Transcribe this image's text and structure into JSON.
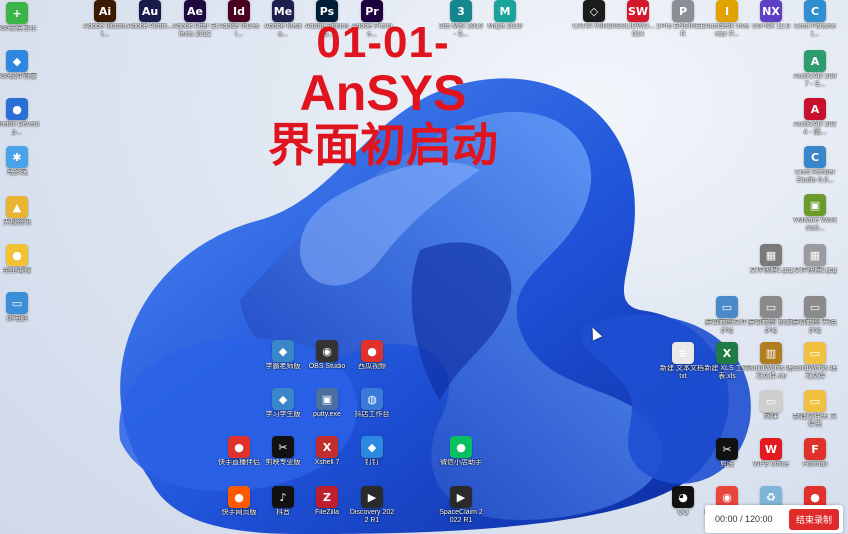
{
  "overlay": {
    "line1": "01-01-",
    "line2": "AnSYS",
    "line3": "界面初启动"
  },
  "recorder": {
    "time": "00:00 / 120:00",
    "stop_label": "结束录制"
  },
  "icons": [
    {
      "name": "icon-360-safeguard",
      "label": "360安全卫士",
      "glyph": "+",
      "color": "#3bb54a"
    },
    {
      "name": "icon-360-software",
      "label": "360软件管家",
      "glyph": "◆",
      "color": "#2f86e0"
    },
    {
      "name": "icon-firefox",
      "label": "Firefox Develop...",
      "glyph": "●",
      "color": "#2b6fd6"
    },
    {
      "name": "icon-app-4",
      "label": "马多玩",
      "glyph": "✱",
      "color": "#4aa3e8"
    },
    {
      "name": "icon-app-5",
      "label": "天极资讯",
      "glyph": "▲",
      "color": "#e8b431"
    },
    {
      "name": "icon-app-6",
      "label": "金山毒霸",
      "glyph": "●",
      "color": "#f1c232"
    },
    {
      "name": "icon-this-pc",
      "label": "此电脑",
      "glyph": "▭",
      "color": "#3a8fd8"
    },
    {
      "name": "icon-illustrator",
      "label": "Adobe Illustrat...",
      "glyph": "Ai",
      "color": "#3a1a00"
    },
    {
      "name": "icon-audition",
      "label": "Adobe Auditi...",
      "glyph": "Au",
      "color": "#1a1a4a"
    },
    {
      "name": "icon-after-effects",
      "label": "Adobe After Effects 2022",
      "glyph": "Ae",
      "color": "#1f0a3f"
    },
    {
      "name": "icon-indesign",
      "label": "Adobe InDesi...",
      "glyph": "Id",
      "color": "#49021f"
    },
    {
      "name": "icon-media-encoder",
      "label": "Adobe Media...",
      "glyph": "Me",
      "color": "#1f1f4f"
    },
    {
      "name": "icon-photoshop",
      "label": "Adobe Photosho...",
      "glyph": "Ps",
      "color": "#001e36"
    },
    {
      "name": "icon-premiere",
      "label": "Adobe Premie...",
      "glyph": "Pr",
      "color": "#1f003f"
    },
    {
      "name": "icon-3dsmax",
      "label": "3ds Max 2019 - S...",
      "glyph": "3",
      "color": "#14878e"
    },
    {
      "name": "icon-maya",
      "label": "Maya 2019",
      "glyph": "M",
      "color": "#1aa39b"
    },
    {
      "name": "icon-catia",
      "label": "CATIA V5R20",
      "glyph": "◇",
      "color": "#1c1c1c"
    },
    {
      "name": "icon-solidworks-2024",
      "label": "SOLIDWO... 2024",
      "glyph": "SW",
      "color": "#d5172b"
    },
    {
      "name": "icon-pro-engineer",
      "label": "Pro ENGINEER",
      "glyph": "P",
      "color": "#8a8f96"
    },
    {
      "name": "icon-autodesk-inventor",
      "label": "Autodesk Inventor P...",
      "glyph": "I",
      "color": "#e0a200"
    },
    {
      "name": "icon-ug-nx",
      "label": "UG-NX 12.0",
      "glyph": "NX",
      "color": "#5f3fc4"
    },
    {
      "name": "icon-creo-parametric",
      "label": "Creo Paramet...",
      "glyph": "C",
      "color": "#2f8fd0"
    },
    {
      "name": "icon-autocad-2007",
      "label": "AutoCAD 2007 - S...",
      "glyph": "A",
      "color": "#2e9c6f"
    },
    {
      "name": "icon-autocad-2024",
      "label": "AutoCAD 2024 - 简...",
      "glyph": "A",
      "color": "#c8102e"
    },
    {
      "name": "icon-creo-render",
      "label": "Creo Render Studio 6.0...",
      "glyph": "C",
      "color": "#3a86c8"
    },
    {
      "name": "icon-vmware",
      "label": "VMware Workstati...",
      "glyph": "▣",
      "color": "#6a9a2a"
    },
    {
      "name": "icon-file-jpg-1",
      "label": "文件快照1.jpg",
      "glyph": "▦",
      "color": "#7a7a7a"
    },
    {
      "name": "icon-file-jpg-2",
      "label": "文件快照2.jpg",
      "glyph": "▦",
      "color": "#9a9aa0"
    },
    {
      "name": "icon-file-png-1",
      "label": "屏幕截图文件.png",
      "glyph": "▭",
      "color": "#4a8ac8"
    },
    {
      "name": "icon-file-png-2",
      "label": "屏幕截图 资源.png",
      "glyph": "▭",
      "color": "#8a8a8a"
    },
    {
      "name": "icon-file-png-3",
      "label": "屏幕截图 开始.png",
      "glyph": "▭",
      "color": "#8a8a8a"
    },
    {
      "name": "icon-new-txt",
      "label": "新建 文本文档.txt",
      "glyph": "≡",
      "color": "#e8e8e8"
    },
    {
      "name": "icon-new-xls",
      "label": "新建 XLS 工作表.xls",
      "glyph": "X",
      "color": "#1f7a45"
    },
    {
      "name": "icon-solidworks-rar",
      "label": "SolidWorks 练习文件.rar",
      "glyph": "▥",
      "color": "#b07d1f"
    },
    {
      "name": "icon-solidworks-folder",
      "label": "SolidWorks 练习文件",
      "glyph": "▭",
      "color": "#f0c040"
    },
    {
      "name": "icon-file-misc",
      "label": "网课",
      "glyph": "▭",
      "color": "#cfcfcf"
    },
    {
      "name": "icon-folder-new",
      "label": "新建文件夹 文件夹",
      "glyph": "▭",
      "color": "#f0c040"
    },
    {
      "name": "icon-wps-office",
      "label": "WPS Office",
      "glyph": "W",
      "color": "#e21a22"
    },
    {
      "name": "icon-foxmail",
      "label": "Foxmail",
      "glyph": "F",
      "color": "#e0312d"
    },
    {
      "name": "icon-jianying",
      "label": "剪映",
      "glyph": "✂",
      "color": "#111111"
    },
    {
      "name": "icon-qq",
      "label": "QQ",
      "glyph": "◕",
      "color": "#111111"
    },
    {
      "name": "icon-chrome",
      "label": "Google Chrome",
      "glyph": "◉",
      "color": "#e8453c"
    },
    {
      "name": "icon-recycle-bin",
      "label": "回收站",
      "glyph": "♻",
      "color": "#7fb6d8"
    },
    {
      "name": "icon-app-mid-1",
      "label": "直播助手",
      "glyph": "●",
      "color": "#e0312d"
    },
    {
      "name": "icon-app-mid-2",
      "label": "学霸老师版",
      "glyph": "◆",
      "color": "#3a86c8"
    },
    {
      "name": "icon-obs",
      "label": "OBS Studio",
      "glyph": "◉",
      "color": "#333333"
    },
    {
      "name": "icon-app-mid-4",
      "label": "西瓜视频",
      "glyph": "●",
      "color": "#e0312d"
    },
    {
      "name": "icon-app-mid-5",
      "label": "学习学生版",
      "glyph": "◆",
      "color": "#3a86c8"
    },
    {
      "name": "icon-putty",
      "label": "putty.exe",
      "glyph": "▣",
      "color": "#4a6fa0"
    },
    {
      "name": "icon-app-mid-7",
      "label": "抖店工作台",
      "glyph": "◍",
      "color": "#3a7ad8"
    },
    {
      "name": "icon-app-mid-8",
      "label": "快手直播伴侣",
      "glyph": "●",
      "color": "#e0312d"
    },
    {
      "name": "icon-capcut-pro",
      "label": "剪映专业版",
      "glyph": "✂",
      "color": "#111111"
    },
    {
      "name": "icon-xshell",
      "label": "Xshell 7",
      "glyph": "X",
      "color": "#c42d2d"
    },
    {
      "name": "icon-dingtalk",
      "label": "钉钉",
      "glyph": "◆",
      "color": "#2a8ae0"
    },
    {
      "name": "icon-wechat-store",
      "label": "微信小店助手",
      "glyph": "●",
      "color": "#07c160"
    },
    {
      "name": "icon-kuaishou-web",
      "label": "快手网页版",
      "glyph": "●",
      "color": "#ff5a00"
    },
    {
      "name": "icon-douyin",
      "label": "抖音",
      "glyph": "♪",
      "color": "#111111"
    },
    {
      "name": "icon-filezilla",
      "label": "FileZilla",
      "glyph": "Z",
      "color": "#bf1e2e"
    },
    {
      "name": "icon-discovery",
      "label": "Discovery 2022 R1",
      "glyph": "▶",
      "color": "#2a2a2a"
    },
    {
      "name": "icon-spaceclaim",
      "label": "SpaceClaim 2022 R1",
      "glyph": "▶",
      "color": "#2a2a2a"
    }
  ]
}
